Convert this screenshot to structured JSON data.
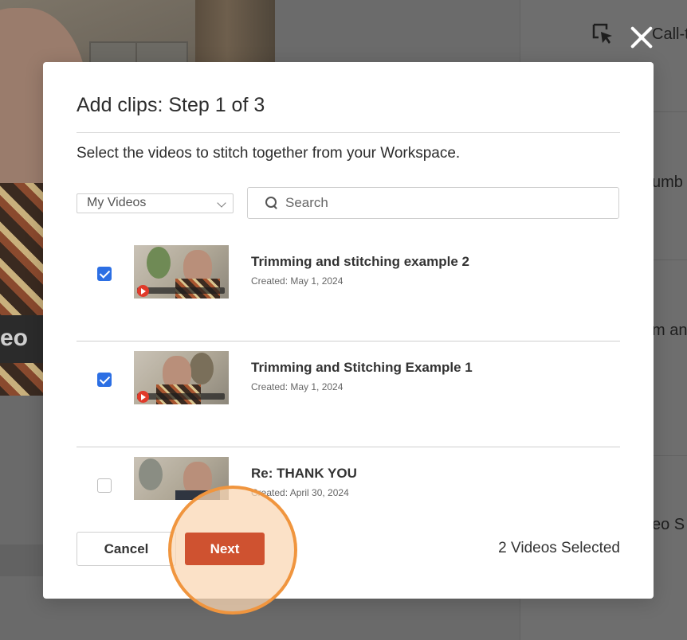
{
  "background": {
    "video_caption": "eo",
    "right_panel_labels": [
      "Call-to",
      "umb",
      "m an",
      "eo S"
    ]
  },
  "modal": {
    "title": "Add clips: Step 1 of 3",
    "description": "Select the videos to stitch together from your Workspace.",
    "source_select": {
      "value": "My Videos"
    },
    "search": {
      "placeholder": "Search",
      "value": ""
    },
    "videos": [
      {
        "title": "Trimming and stitching example 2",
        "created": "Created: May 1, 2024",
        "selected": true
      },
      {
        "title": "Trimming and Stitching Example 1",
        "created": "Created: May 1, 2024",
        "selected": true
      },
      {
        "title": "Re: THANK YOU",
        "created": "Created: April 30, 2024",
        "selected": false
      }
    ],
    "cancel_label": "Cancel",
    "next_label": "Next",
    "selected_count_text": "2 Videos Selected"
  },
  "colors": {
    "accent": "#cf5230",
    "checkbox_checked": "#2c6fe4",
    "highlight_ring": "#f0953e"
  },
  "icons": [
    "pointer-select-icon",
    "close-icon",
    "chevron-down-icon",
    "search-icon",
    "play-icon"
  ]
}
